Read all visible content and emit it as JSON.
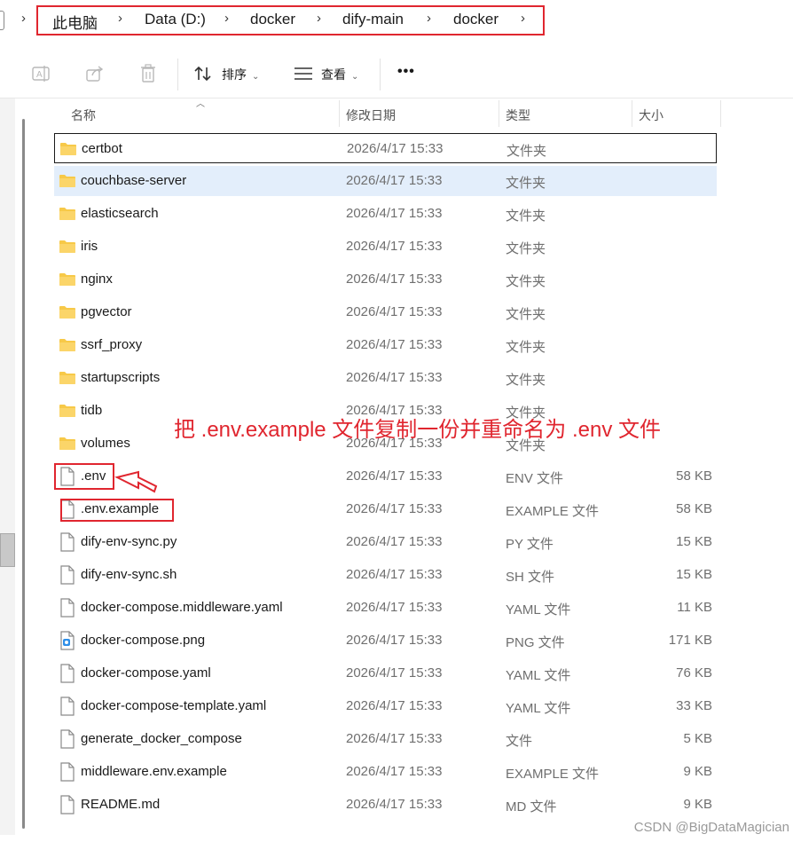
{
  "breadcrumb": {
    "items": [
      "此电脑",
      "Data (D:)",
      "docker",
      "dify-main",
      "docker"
    ]
  },
  "toolbar": {
    "sort_label": "排序",
    "view_label": "查看",
    "more_label": "•••"
  },
  "columns": {
    "name": "名称",
    "date": "修改日期",
    "type": "类型",
    "size": "大小"
  },
  "files": [
    {
      "name": "certbot",
      "date": "2026/4/17 15:33",
      "type": "文件夹",
      "size": "",
      "icon": "folder-icon"
    },
    {
      "name": "couchbase-server",
      "date": "2026/4/17 15:33",
      "type": "文件夹",
      "size": "",
      "icon": "folder-icon"
    },
    {
      "name": "elasticsearch",
      "date": "2026/4/17 15:33",
      "type": "文件夹",
      "size": "",
      "icon": "folder-icon"
    },
    {
      "name": "iris",
      "date": "2026/4/17 15:33",
      "type": "文件夹",
      "size": "",
      "icon": "folder-icon"
    },
    {
      "name": "nginx",
      "date": "2026/4/17 15:33",
      "type": "文件夹",
      "size": "",
      "icon": "folder-icon"
    },
    {
      "name": "pgvector",
      "date": "2026/4/17 15:33",
      "type": "文件夹",
      "size": "",
      "icon": "folder-icon"
    },
    {
      "name": "ssrf_proxy",
      "date": "2026/4/17 15:33",
      "type": "文件夹",
      "size": "",
      "icon": "folder-icon"
    },
    {
      "name": "startupscripts",
      "date": "2026/4/17 15:33",
      "type": "文件夹",
      "size": "",
      "icon": "folder-icon"
    },
    {
      "name": "tidb",
      "date": "2026/4/17 15:33",
      "type": "文件夹",
      "size": "",
      "icon": "folder-icon"
    },
    {
      "name": "volumes",
      "date": "2026/4/17 15:33",
      "type": "文件夹",
      "size": "",
      "icon": "folder-icon"
    },
    {
      "name": ".env",
      "date": "2026/4/17 15:33",
      "type": "ENV 文件",
      "size": "58 KB",
      "icon": "file-icon"
    },
    {
      "name": ".env.example",
      "date": "2026/4/17 15:33",
      "type": "EXAMPLE 文件",
      "size": "58 KB",
      "icon": "file-icon"
    },
    {
      "name": "dify-env-sync.py",
      "date": "2026/4/17 15:33",
      "type": "PY 文件",
      "size": "15 KB",
      "icon": "file-icon"
    },
    {
      "name": "dify-env-sync.sh",
      "date": "2026/4/17 15:33",
      "type": "SH 文件",
      "size": "15 KB",
      "icon": "file-icon"
    },
    {
      "name": "docker-compose.middleware.yaml",
      "date": "2026/4/17 15:33",
      "type": "YAML 文件",
      "size": "11 KB",
      "icon": "file-icon"
    },
    {
      "name": "docker-compose.png",
      "date": "2026/4/17 15:33",
      "type": "PNG 文件",
      "size": "171 KB",
      "icon": "image-file-icon"
    },
    {
      "name": "docker-compose.yaml",
      "date": "2026/4/17 15:33",
      "type": "YAML 文件",
      "size": "76 KB",
      "icon": "file-icon"
    },
    {
      "name": "docker-compose-template.yaml",
      "date": "2026/4/17 15:33",
      "type": "YAML 文件",
      "size": "33 KB",
      "icon": "file-icon"
    },
    {
      "name": "generate_docker_compose",
      "date": "2026/4/17 15:33",
      "type": "文件",
      "size": "5 KB",
      "icon": "file-icon"
    },
    {
      "name": "middleware.env.example",
      "date": "2026/4/17 15:33",
      "type": "EXAMPLE 文件",
      "size": "9 KB",
      "icon": "file-icon"
    },
    {
      "name": "README.md",
      "date": "2026/4/17 15:33",
      "type": "MD 文件",
      "size": "9 KB",
      "icon": "file-icon"
    }
  ],
  "annotation": "把 .env.example 文件复制一份并重命名为 .env 文件",
  "watermark": "CSDN @BigDataMagician",
  "colors": {
    "highlight_red": "#e0262f",
    "hover_row": "#e3eefb",
    "folder_yellow": "#f7c948"
  }
}
